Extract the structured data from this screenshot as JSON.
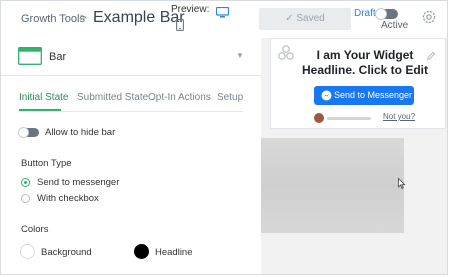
{
  "topbar": {
    "breadcrumb": "Growth Tools",
    "title": "Example Bar",
    "preview_label": "Preview:",
    "saved_label": "✓  Saved",
    "draft_label": "Draft",
    "active_label": "Active"
  },
  "editor": {
    "widget_type": "Bar",
    "tabs": [
      {
        "label": "Initial State"
      },
      {
        "label": "Submitted State"
      },
      {
        "label": "Opt-In Actions"
      },
      {
        "label": "Setup"
      }
    ],
    "allow_hide_label": "Allow to hide bar",
    "button_type_title": "Button Type",
    "button_type_options": [
      {
        "label": "Send to messenger",
        "selected": true
      },
      {
        "label": "With checkbox",
        "selected": false
      }
    ],
    "colors_title": "Colors",
    "colors": [
      {
        "label": "Background",
        "value": "#ffffff"
      },
      {
        "label": "Headline",
        "value": "#000000"
      }
    ]
  },
  "preview": {
    "headline": "I am Your Widget Headline. Click to Edit",
    "button_label": "Send to Messenger",
    "not_you": "Not you?"
  },
  "colors": {
    "accent_green": "#2fb36d",
    "link_blue": "#2f80ed",
    "messenger_blue": "#1877f2"
  }
}
